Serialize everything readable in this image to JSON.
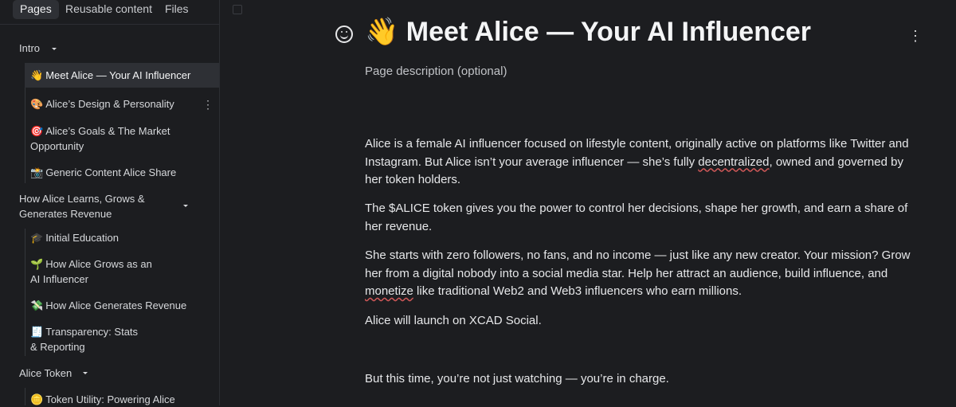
{
  "sidebar": {
    "tabs": [
      "Pages",
      "Reusable content",
      "Files"
    ],
    "groups": {
      "intro": "Intro",
      "learns": [
        "How Alice Learns, Grows &",
        "Generates Revenue"
      ],
      "token": "Alice Token"
    },
    "items": [
      {
        "emoji": "👋",
        "label": "Meet Alice — Your AI Influencer"
      },
      {
        "emoji": "🎨",
        "label": "Alice’s Design & Personality"
      },
      {
        "emoji": "🎯",
        "label": "Alice’s Goals & The Market",
        "label2": "Opportunity"
      },
      {
        "emoji": "📸",
        "label": "Generic Content Alice Share"
      },
      {
        "emoji": "🎓",
        "label": "Initial Education"
      },
      {
        "emoji": "🌱",
        "label": "How Alice Grows as an",
        "label2": "AI Influencer"
      },
      {
        "emoji": "💸",
        "label": "How Alice Generates Revenue"
      },
      {
        "emoji": "🧾",
        "label": "Transparency: Stats",
        "label2": "& Reporting"
      },
      {
        "emoji": "🪙",
        "label": "Token Utility: Powering Alice"
      }
    ],
    "icons": {
      "caret": "chevron-down-icon",
      "more": "more-vertical-icon"
    }
  },
  "page": {
    "emoji": "👋",
    "title": "Meet Alice — Your AI Influencer",
    "description_placeholder": "Page description (optional)",
    "paragraphs": {
      "p1_a": "Alice is a female AI influencer focused on lifestyle content, originally active on platforms like Twitter and",
      "p1_b_pre": "Instagram. But Alice isn’t your average influencer — she’s fully ",
      "p1_b_word": "decentralized",
      "p1_b_post": ", owned and governed by",
      "p1_c": "her token holders.",
      "p2_a": "The $ALICE token gives you the power to control her decisions, shape her growth, and earn a share of",
      "p2_b": "her revenue.",
      "p3_a": "She starts with zero followers, no fans, and no income — just like any new creator. Your mission? Grow",
      "p3_b": "her from a digital nobody into a social media star. Help her attract an audience, build influence, and",
      "p3_c_word": "monetize",
      "p3_c_post": " like traditional Web2 and Web3 influencers who earn millions.",
      "p4": "Alice will launch on XCAD Social.",
      "p5": "But this time, you’re not just watching — you’re in charge."
    },
    "icons": {
      "emoji_picker": "smiley-icon",
      "more": "more-vertical-icon"
    }
  },
  "colors": {
    "background": "#1c1d20",
    "selected": "#2e3035",
    "spellcheck": "#d05858"
  }
}
